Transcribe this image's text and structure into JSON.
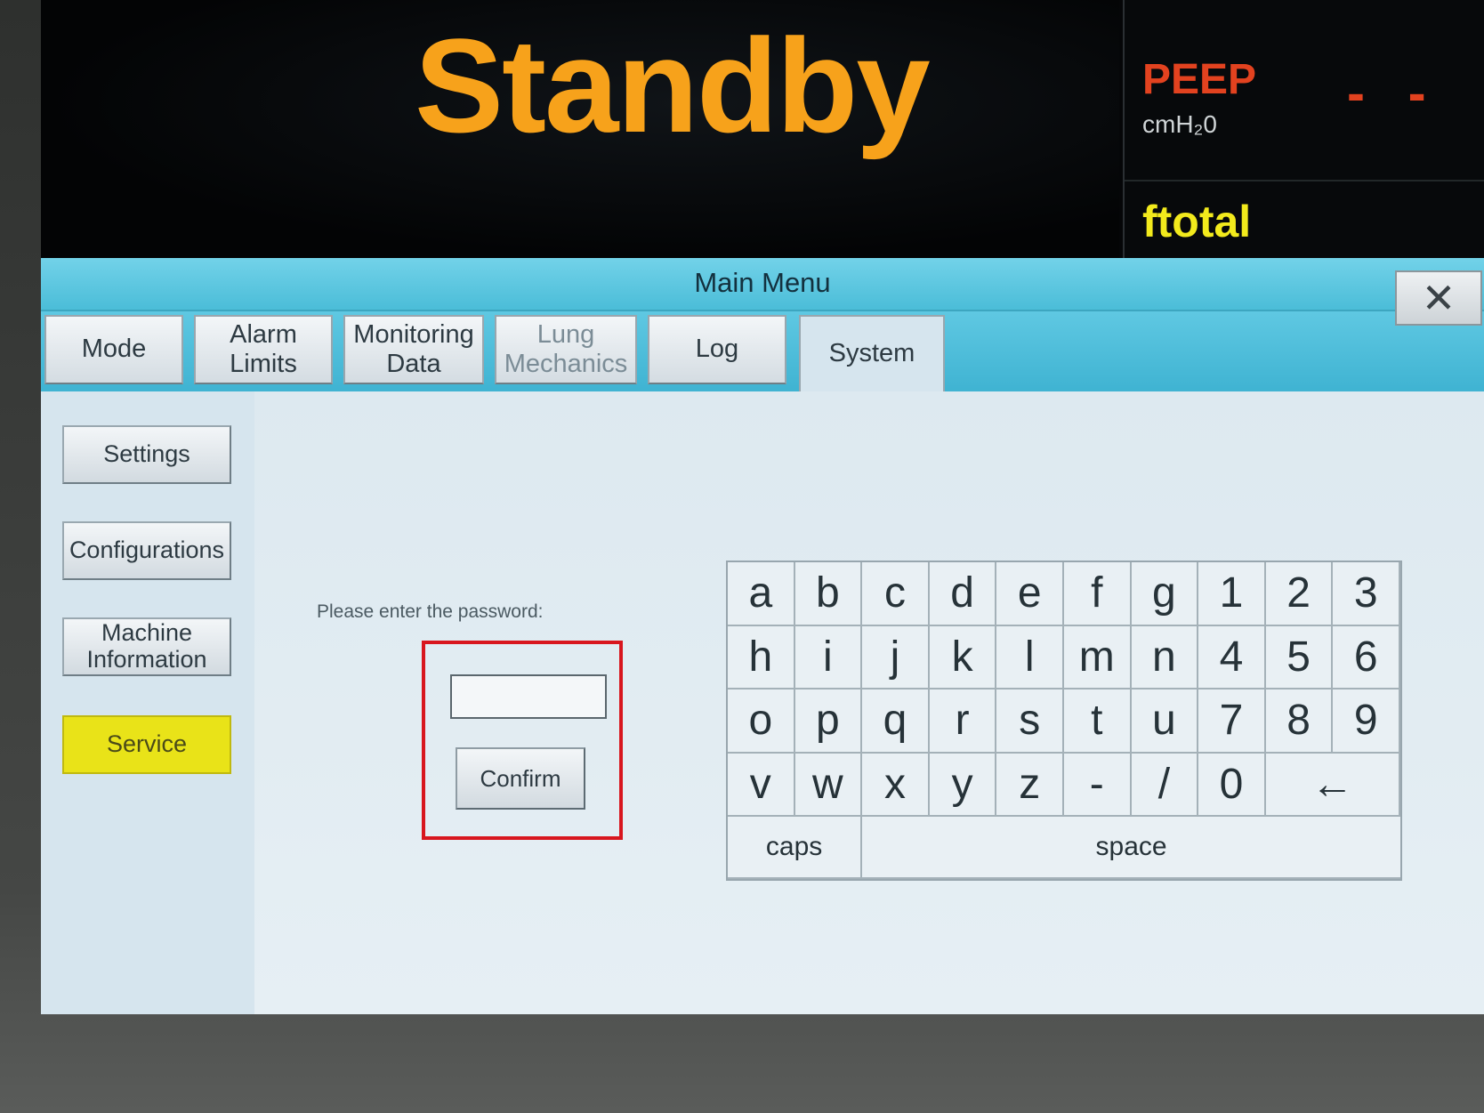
{
  "status": {
    "mode_text": "Standby",
    "peep_label": "PEEP",
    "peep_unit": "cmH₂0",
    "peep_value": "- -",
    "ftotal_label": "ftotal"
  },
  "menu": {
    "title": "Main Menu",
    "close_icon": "close-icon",
    "tabs": [
      {
        "label": "Mode"
      },
      {
        "label": "Alarm\nLimits"
      },
      {
        "label": "Monitoring\nData"
      },
      {
        "label": "Lung\nMechanics"
      },
      {
        "label": "Log"
      },
      {
        "label": "System"
      }
    ],
    "active_tab": "System",
    "sidebar": [
      {
        "label": "Settings"
      },
      {
        "label": "Configurations"
      },
      {
        "label": "Machine\nInformation"
      },
      {
        "label": "Service"
      }
    ],
    "active_sidebar": "Service",
    "password": {
      "prompt": "Please enter the password:",
      "value": "",
      "confirm_label": "Confirm"
    },
    "keyboard": {
      "rows": [
        [
          "a",
          "b",
          "c",
          "d",
          "e",
          "f",
          "g",
          "1",
          "2",
          "3"
        ],
        [
          "h",
          "i",
          "j",
          "k",
          "l",
          "m",
          "n",
          "4",
          "5",
          "6"
        ],
        [
          "o",
          "p",
          "q",
          "r",
          "s",
          "t",
          "u",
          "7",
          "8",
          "9"
        ],
        [
          "v",
          "w",
          "x",
          "y",
          "z",
          "-",
          "/",
          "0",
          "←"
        ]
      ],
      "caps_label": "caps",
      "space_label": "space"
    }
  },
  "colors": {
    "standby": "#f7a21b",
    "peep": "#e2421f",
    "ftotal": "#f2ea1c",
    "service_button": "#e9e318",
    "highlight": "#d8161e",
    "titlebar": "#4bbdd8"
  }
}
